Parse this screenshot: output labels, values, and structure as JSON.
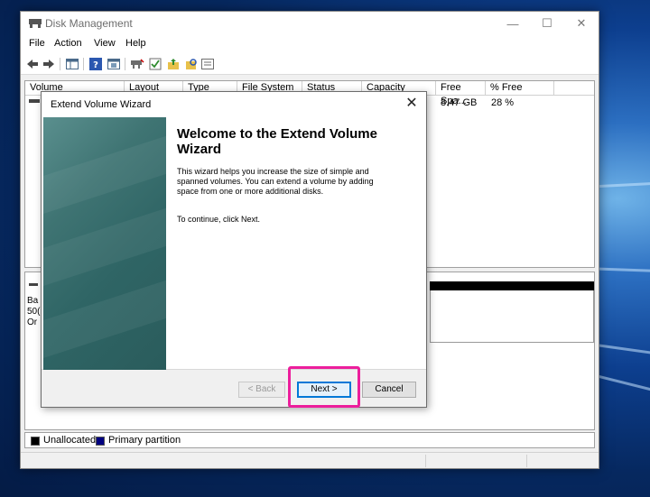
{
  "window": {
    "title": "Disk Management",
    "controls": {
      "minimize": "—",
      "maximize": "☐",
      "close": "✕"
    }
  },
  "menu": [
    "File",
    "Action",
    "View",
    "Help"
  ],
  "toolbar": {
    "icons": [
      "back-arrow-icon",
      "forward-arrow-icon",
      "show-pane-icon",
      "help-icon",
      "properties-icon",
      "connect-icon",
      "check-icon",
      "folder-up-icon",
      "search-folder-icon",
      "list-icon"
    ]
  },
  "volume_list": {
    "columns": [
      "Volume",
      "Layout",
      "Type",
      "File System",
      "Status",
      "Capacity",
      "Free Spa...",
      "% Free"
    ],
    "row": {
      "free_space": "8.47 GB",
      "percent_free": "28 %"
    }
  },
  "disk_pane": {
    "label_lines": [
      "Ba",
      "50(",
      "Or"
    ]
  },
  "legend": {
    "unallocated": "Unallocated",
    "primary": "Primary partition",
    "colors": {
      "unallocated": "#000000",
      "primary": "#000080"
    }
  },
  "wizard": {
    "title": "Extend Volume Wizard",
    "close": "✕",
    "heading": "Welcome to the Extend Volume Wizard",
    "description": "This wizard helps you increase the size of simple and spanned volumes. You can extend a volume  by adding space from one or more additional disks.",
    "continue_text": "To continue, click Next.",
    "buttons": {
      "back": "< Back",
      "next": "Next >",
      "cancel": "Cancel"
    }
  },
  "highlight_color": "#ec1e9c"
}
